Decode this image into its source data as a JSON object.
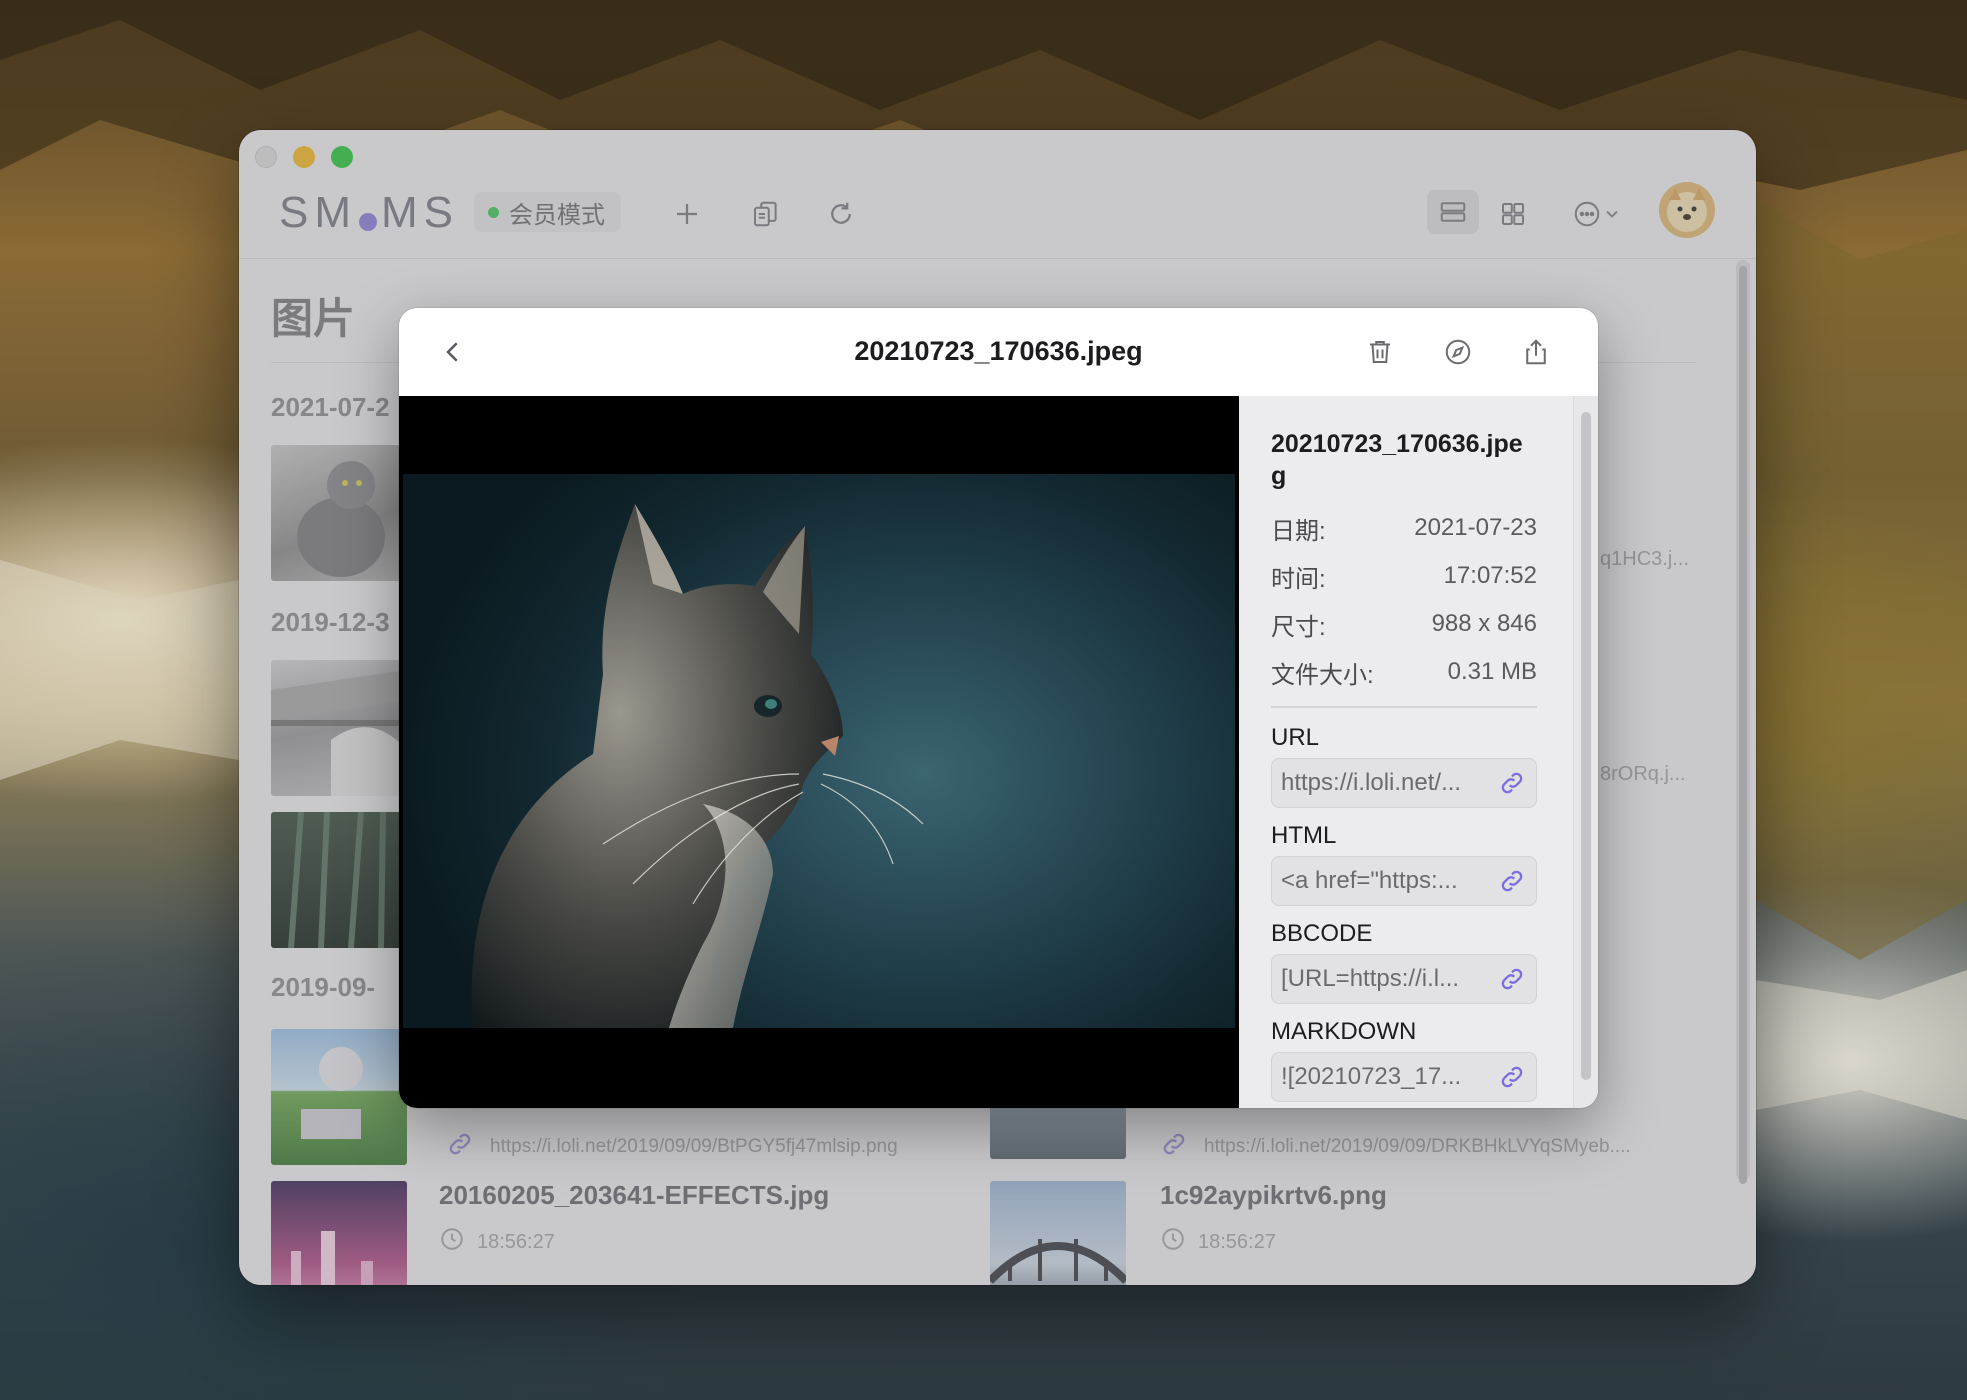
{
  "app": {
    "logo_left": "SM",
    "logo_right": "MS",
    "member_mode": "会员模式",
    "page_title": "图片"
  },
  "toolbar": {
    "icons": [
      "plus-icon",
      "copy-icon",
      "refresh-icon",
      "list-view-icon",
      "grid-view-icon",
      "more-icon",
      "chevron-down-icon"
    ]
  },
  "gallery": {
    "groups": [
      {
        "date": "2021-07-2",
        "side_text": "q1HC3.j..."
      },
      {
        "date": "2019-12-3",
        "side_text": "8rORq.j..."
      },
      {
        "date": "2019-09-"
      }
    ],
    "row1": [
      {
        "url": "https://i.loli.net/2019/09/09/BtPGY5fj47mlsip.png"
      },
      {
        "url": "https://i.loli.net/2019/09/09/DRKBHkLVYqSMyeb...."
      }
    ],
    "row2": [
      {
        "title": "20160205_203641-EFFECTS.jpg",
        "time": "18:56:27"
      },
      {
        "title": "1c92aypikrtv6.png",
        "time": "18:56:27"
      }
    ]
  },
  "modal": {
    "title": "20210723_170636.jpeg",
    "info": {
      "filename": "20210723_170636.jpeg",
      "date_label": "日期:",
      "date_value": "2021-07-23",
      "time_label": "时间:",
      "time_value": "17:07:52",
      "size_label": "尺寸:",
      "size_value": "988 x 846",
      "filesize_label": "文件大小:",
      "filesize_value": "0.31 MB",
      "links": [
        {
          "label": "URL",
          "value": "https://i.loli.net/..."
        },
        {
          "label": "HTML",
          "value": "<a href=\"https:..."
        },
        {
          "label": "BBCODE",
          "value": "[URL=https://i.l..."
        },
        {
          "label": "MARKDOWN",
          "value": "![20210723_17..."
        }
      ]
    }
  },
  "colors": {
    "accent": "#7b6fe0",
    "status_green": "#42c85a",
    "traffic_yellow": "#f3bb2c",
    "traffic_green": "#2fc840"
  }
}
